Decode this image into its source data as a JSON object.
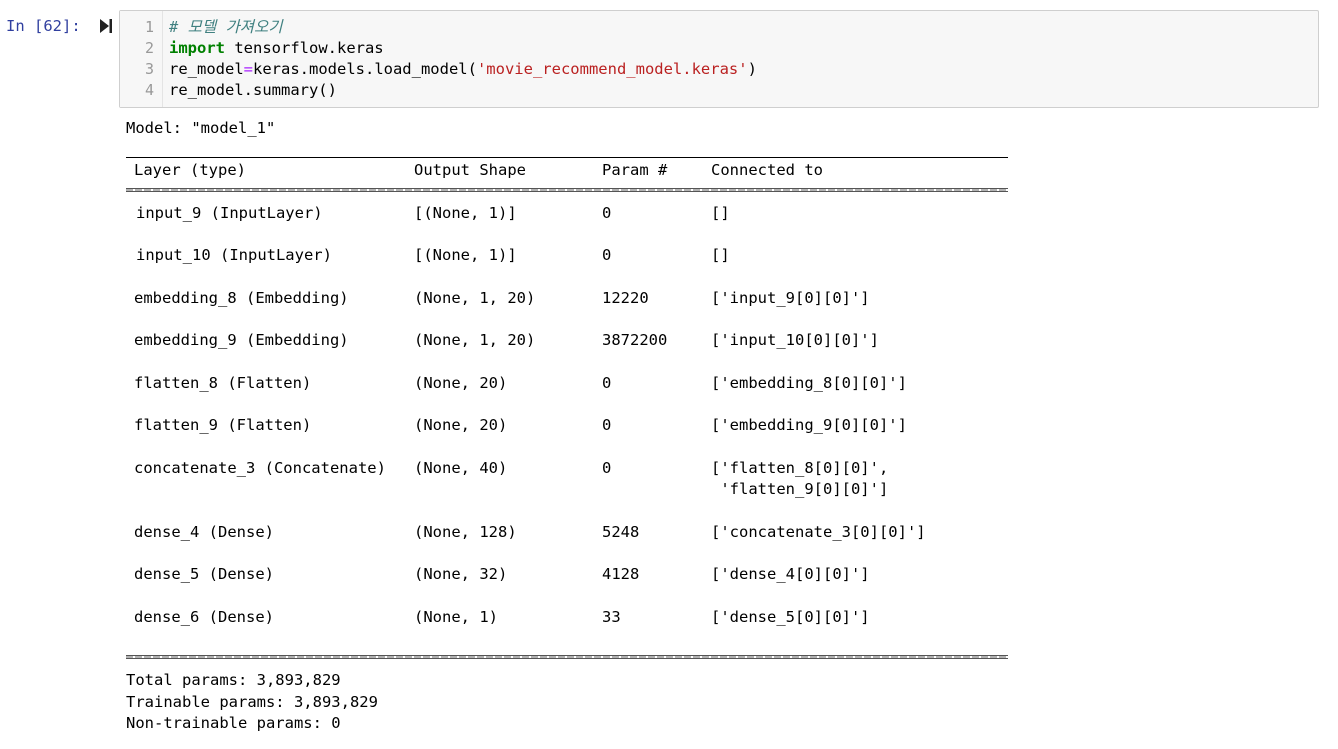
{
  "prompt": "In [62]:",
  "code": {
    "line_numbers": [
      "1",
      "2",
      "3",
      "4"
    ],
    "line1_comment": "# 모델 가져오기",
    "line2_kw": "import",
    "line2_rest": " tensorflow.keras",
    "line3_a": "re_model",
    "line3_op": "=",
    "line3_b": "keras.models.load_model(",
    "line3_str": "'movie_recommend_model.keras'",
    "line3_c": ")",
    "line4": "re_model.summary()"
  },
  "output": {
    "model_line": "Model: \"model_1\"",
    "headers": {
      "layer": "Layer (type)",
      "shape": "Output Shape",
      "param": "Param #",
      "connected": "Connected to"
    },
    "rows": [
      {
        "layer": "input_9 (InputLayer)",
        "shape": "[(None, 1)]",
        "param": "0",
        "connected": "[]"
      },
      {
        "layer": "input_10 (InputLayer)",
        "shape": "[(None, 1)]",
        "param": "0",
        "connected": "[]"
      },
      {
        "layer": "embedding_8 (Embedding)",
        "shape": "(None, 1, 20)",
        "param": "12220",
        "connected": "['input_9[0][0]']"
      },
      {
        "layer": "embedding_9 (Embedding)",
        "shape": "(None, 1, 20)",
        "param": "3872200",
        "connected": "['input_10[0][0]']"
      },
      {
        "layer": "flatten_8 (Flatten)",
        "shape": "(None, 20)",
        "param": "0",
        "connected": "['embedding_8[0][0]']"
      },
      {
        "layer": "flatten_9 (Flatten)",
        "shape": "(None, 20)",
        "param": "0",
        "connected": "['embedding_9[0][0]']"
      },
      {
        "layer": "concatenate_3 (Concatenate)",
        "shape": "(None, 40)",
        "param": "0",
        "connected": "['flatten_8[0][0]',",
        "connected2": " 'flatten_9[0][0]']"
      },
      {
        "layer": "dense_4 (Dense)",
        "shape": "(None, 128)",
        "param": "5248",
        "connected": "['concatenate_3[0][0]']"
      },
      {
        "layer": "dense_5 (Dense)",
        "shape": "(None, 32)",
        "param": "4128",
        "connected": "['dense_4[0][0]']"
      },
      {
        "layer": "dense_6 (Dense)",
        "shape": "(None, 1)",
        "param": "33",
        "connected": "['dense_5[0][0]']"
      }
    ],
    "total_params": "Total params: 3,893,829",
    "trainable_params": "Trainable params: 3,893,829",
    "non_trainable_params": "Non-trainable params: 0"
  },
  "colors": {
    "prompt": "#303f9f",
    "comment": "#408080",
    "keyword": "#008000",
    "operator": "#aa22ff",
    "string": "#ba2121",
    "cell_bg": "#f7f7f7"
  },
  "icons": {
    "run": "run-cell-icon"
  }
}
